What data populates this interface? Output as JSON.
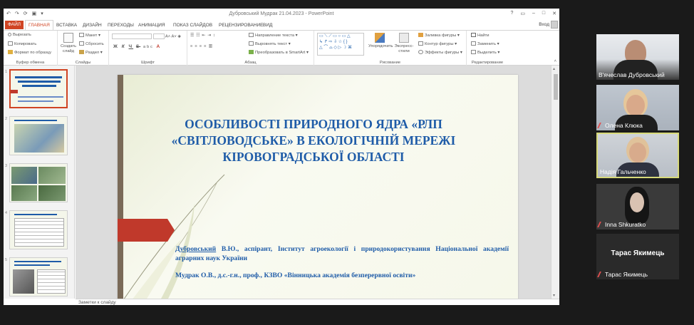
{
  "window": {
    "title": "Дубровський Мудрак 21.04.2023 - PowerPoint",
    "signin": "Вход"
  },
  "tabs": {
    "file": "ФАЙЛ",
    "home": "ГЛАВНАЯ",
    "insert": "ВСТАВКА",
    "design": "ДИЗАЙН",
    "transitions": "ПЕРЕХОДЫ",
    "animation": "АНИМАЦИЯ",
    "slideshow": "ПОКАЗ СЛАЙДОВ",
    "review": "РЕЦЕНЗИРОВАНИЕ",
    "view": "ВИД"
  },
  "ribbon": {
    "clipboard": {
      "label": "Буфер обмена",
      "paste": "Вставить",
      "cut": "Вырезать",
      "copy": "Копировать",
      "format_painter": "Формат по образцу"
    },
    "slides": {
      "label": "Слайды",
      "new_slide": "Создать слайд",
      "layout": "Макет",
      "reset": "Сбросить",
      "section": "Раздел"
    },
    "font": {
      "label": "Шрифт",
      "bold": "Ж",
      "italic": "К",
      "underline": "Ч",
      "strike": "S",
      "spacing": "abc"
    },
    "paragraph": {
      "label": "Абзац",
      "text_direction": "Направление текста",
      "align_text": "Выровнять текст",
      "smartart": "Преобразовать в SmartArt"
    },
    "drawing": {
      "label": "Рисование",
      "arrange": "Упорядочить",
      "quick_styles": "Экспресс-стили",
      "shape_fill": "Заливка фигуры",
      "shape_outline": "Контур фигуры",
      "shape_effects": "Эффекты фигуры"
    },
    "editing": {
      "label": "Редактирование",
      "find": "Найти",
      "replace": "Заменить",
      "select": "Выделить"
    }
  },
  "slide": {
    "title_line1": "ОСОБЛИВОСТІ ПРИРОДНОГО ЯДРА «РЛП",
    "title_line2": "«СВІТЛОВОДСЬКЕ» В ЕКОЛОГІЧНІЙ МЕРЕЖІ",
    "title_line3": "КІРОВОГРАДСЬКОЇ ОБЛАСТІ",
    "author1_name": "Дубровський",
    "author1_rest": " В.Ю., аспірант, Інститут агроекології і природокористування Національної академії аграрних наук України",
    "author2": "Мудрак О.В., д.с.-г.н., проф., КЗВО «Вінницька академія безперервної освіти»"
  },
  "thumbnails": {
    "nums": [
      "1",
      "2",
      "3",
      "4",
      "5"
    ]
  },
  "notes": {
    "placeholder": "Заметки к слайду"
  },
  "participants": [
    {
      "name": "В'ячеслав Дубровський"
    },
    {
      "name": "Олена Клюка"
    },
    {
      "name": "Надія Гальченко"
    },
    {
      "name": "Inna Shkuratko"
    },
    {
      "name": "Тарас Якимець",
      "initials": "Тарас Якимець"
    }
  ],
  "colors": {
    "accent": "#d04423",
    "slide_text": "#1f5ca8",
    "active_speaker": "#d7d97a",
    "muted_mic": "#e05050"
  }
}
